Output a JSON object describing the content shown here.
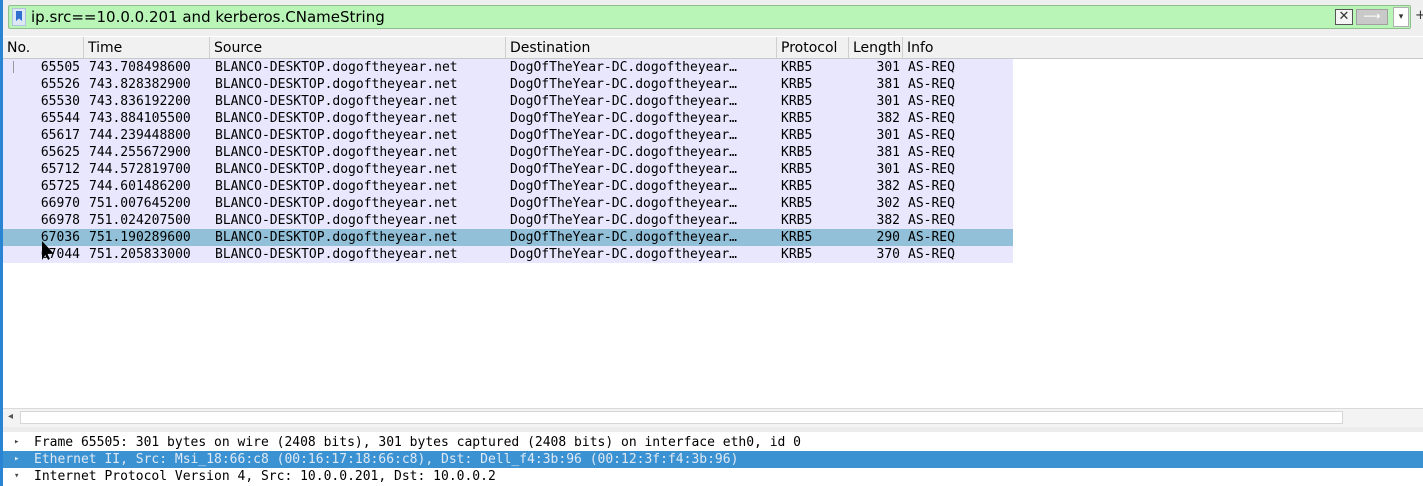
{
  "filter": {
    "value": "ip.src==10.0.0.201 and kerberos.CNameString",
    "clear_glyph": "✕",
    "apply_glyph": "⟶",
    "dropdown_glyph": "▾",
    "plus_glyph": "+"
  },
  "columns": [
    "No.",
    "Time",
    "Source",
    "Destination",
    "Protocol",
    "Length",
    "Info"
  ],
  "packets": [
    {
      "no": "65505",
      "time": "743.708498600",
      "source": "BLANCO-DESKTOP.dogoftheyear.net",
      "destination": "DogOfTheYear-DC.dogoftheyear…",
      "protocol": "KRB5",
      "length": "301",
      "info": "AS-REQ"
    },
    {
      "no": "65526",
      "time": "743.828382900",
      "source": "BLANCO-DESKTOP.dogoftheyear.net",
      "destination": "DogOfTheYear-DC.dogoftheyear…",
      "protocol": "KRB5",
      "length": "381",
      "info": "AS-REQ"
    },
    {
      "no": "65530",
      "time": "743.836192200",
      "source": "BLANCO-DESKTOP.dogoftheyear.net",
      "destination": "DogOfTheYear-DC.dogoftheyear…",
      "protocol": "KRB5",
      "length": "301",
      "info": "AS-REQ"
    },
    {
      "no": "65544",
      "time": "743.884105500",
      "source": "BLANCO-DESKTOP.dogoftheyear.net",
      "destination": "DogOfTheYear-DC.dogoftheyear…",
      "protocol": "KRB5",
      "length": "382",
      "info": "AS-REQ"
    },
    {
      "no": "65617",
      "time": "744.239448800",
      "source": "BLANCO-DESKTOP.dogoftheyear.net",
      "destination": "DogOfTheYear-DC.dogoftheyear…",
      "protocol": "KRB5",
      "length": "301",
      "info": "AS-REQ"
    },
    {
      "no": "65625",
      "time": "744.255672900",
      "source": "BLANCO-DESKTOP.dogoftheyear.net",
      "destination": "DogOfTheYear-DC.dogoftheyear…",
      "protocol": "KRB5",
      "length": "381",
      "info": "AS-REQ"
    },
    {
      "no": "65712",
      "time": "744.572819700",
      "source": "BLANCO-DESKTOP.dogoftheyear.net",
      "destination": "DogOfTheYear-DC.dogoftheyear…",
      "protocol": "KRB5",
      "length": "301",
      "info": "AS-REQ"
    },
    {
      "no": "65725",
      "time": "744.601486200",
      "source": "BLANCO-DESKTOP.dogoftheyear.net",
      "destination": "DogOfTheYear-DC.dogoftheyear…",
      "protocol": "KRB5",
      "length": "382",
      "info": "AS-REQ"
    },
    {
      "no": "66970",
      "time": "751.007645200",
      "source": "BLANCO-DESKTOP.dogoftheyear.net",
      "destination": "DogOfTheYear-DC.dogoftheyear…",
      "protocol": "KRB5",
      "length": "302",
      "info": "AS-REQ"
    },
    {
      "no": "66978",
      "time": "751.024207500",
      "source": "BLANCO-DESKTOP.dogoftheyear.net",
      "destination": "DogOfTheYear-DC.dogoftheyear…",
      "protocol": "KRB5",
      "length": "382",
      "info": "AS-REQ"
    },
    {
      "no": "67036",
      "time": "751.190289600",
      "source": "BLANCO-DESKTOP.dogoftheyear.net",
      "destination": "DogOfTheYear-DC.dogoftheyear…",
      "protocol": "KRB5",
      "length": "290",
      "info": "AS-REQ",
      "selected": true
    },
    {
      "no": "67044",
      "time": "751.205833000",
      "source": "BLANCO-DESKTOP.dogoftheyear.net",
      "destination": "DogOfTheYear-DC.dogoftheyear…",
      "protocol": "KRB5",
      "length": "370",
      "info": "AS-REQ"
    }
  ],
  "details": [
    {
      "arrow": "▸",
      "text": "Frame 65505: 301 bytes on wire (2408 bits), 301 bytes captured (2408 bits) on interface eth0, id 0",
      "highlighted": false
    },
    {
      "arrow": "▸",
      "text": "Ethernet II, Src: Msi_18:66:c8 (00:16:17:18:66:c8), Dst: Dell_f4:3b:96 (00:12:3f:f4:3b:96)",
      "highlighted": true
    },
    {
      "arrow": "▾",
      "text": "Internet Protocol Version 4, Src: 10.0.0.201, Dst: 10.0.0.2",
      "highlighted": false
    }
  ],
  "scroll_left_glyph": "◂",
  "colors": {
    "filter_valid_bg": "#b8f5b6",
    "row_bg": "#e8e7fe",
    "row_selected_bg": "#92c0d9",
    "detail_highlight_bg": "#3b92d3"
  }
}
